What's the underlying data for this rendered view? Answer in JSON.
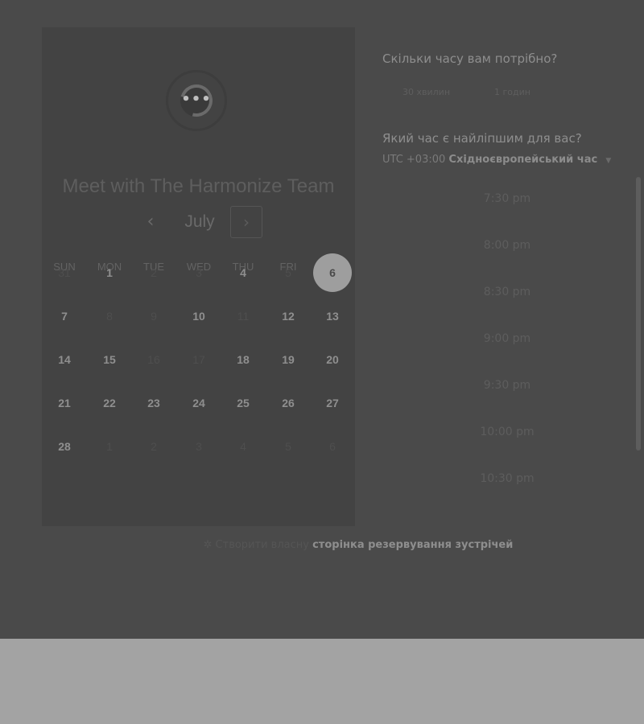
{
  "calendar": {
    "title": "Meet with The Harmonize Team",
    "month": "July",
    "prev_icon": "chevron-left-icon",
    "next_icon": "chevron-right-icon",
    "weekdays": [
      "SUN",
      "MON",
      "TUE",
      "WED",
      "THU",
      "FRI",
      "SAT"
    ],
    "weeks": [
      [
        {
          "d": "31",
          "s": "muted"
        },
        {
          "d": "1",
          "s": "available"
        },
        {
          "d": "2",
          "s": "muted"
        },
        {
          "d": "3",
          "s": "muted"
        },
        {
          "d": "4",
          "s": "available"
        },
        {
          "d": "5",
          "s": "muted"
        },
        {
          "d": "6",
          "s": "selected"
        }
      ],
      [
        {
          "d": "7",
          "s": "available"
        },
        {
          "d": "8",
          "s": "muted"
        },
        {
          "d": "9",
          "s": "muted"
        },
        {
          "d": "10",
          "s": "available"
        },
        {
          "d": "11",
          "s": "muted"
        },
        {
          "d": "12",
          "s": "available"
        },
        {
          "d": "13",
          "s": "available"
        }
      ],
      [
        {
          "d": "14",
          "s": "available"
        },
        {
          "d": "15",
          "s": "available"
        },
        {
          "d": "16",
          "s": "muted"
        },
        {
          "d": "17",
          "s": "muted"
        },
        {
          "d": "18",
          "s": "available"
        },
        {
          "d": "19",
          "s": "available"
        },
        {
          "d": "20",
          "s": "available"
        }
      ],
      [
        {
          "d": "21",
          "s": "available"
        },
        {
          "d": "22",
          "s": "available"
        },
        {
          "d": "23",
          "s": "available"
        },
        {
          "d": "24",
          "s": "available"
        },
        {
          "d": "25",
          "s": "available"
        },
        {
          "d": "26",
          "s": "available"
        },
        {
          "d": "27",
          "s": "available"
        }
      ],
      [
        {
          "d": "28",
          "s": "available"
        },
        {
          "d": "1",
          "s": "muted"
        },
        {
          "d": "2",
          "s": "muted"
        },
        {
          "d": "3",
          "s": "muted"
        },
        {
          "d": "4",
          "s": "muted"
        },
        {
          "d": "5",
          "s": "muted"
        },
        {
          "d": "6",
          "s": "muted"
        }
      ]
    ]
  },
  "booking": {
    "duration_question": "Скільки часу вам потрібно?",
    "durations": [
      "30 хвилин",
      "1 годин"
    ],
    "time_question": "Який час є найліпшим для вас?",
    "timezone_offset": "UTC +03:00",
    "timezone_name": "Східноєвропейський час",
    "timezone_caret_icon": "caret-down-icon",
    "slots": [
      "7:30 pm",
      "8:00 pm",
      "8:30 pm",
      "9:00 pm",
      "9:30 pm",
      "10:00 pm",
      "10:30 pm"
    ]
  },
  "footer": {
    "icon": "sparkle-icon",
    "prefix": "Створити власну",
    "link": "сторінка резервування зустрічей"
  },
  "colors": {
    "overlay": "#4a4a4a",
    "panel": "#434343",
    "page_bottom": "#a3a3a3",
    "selected_day": "#9e9e9e"
  }
}
